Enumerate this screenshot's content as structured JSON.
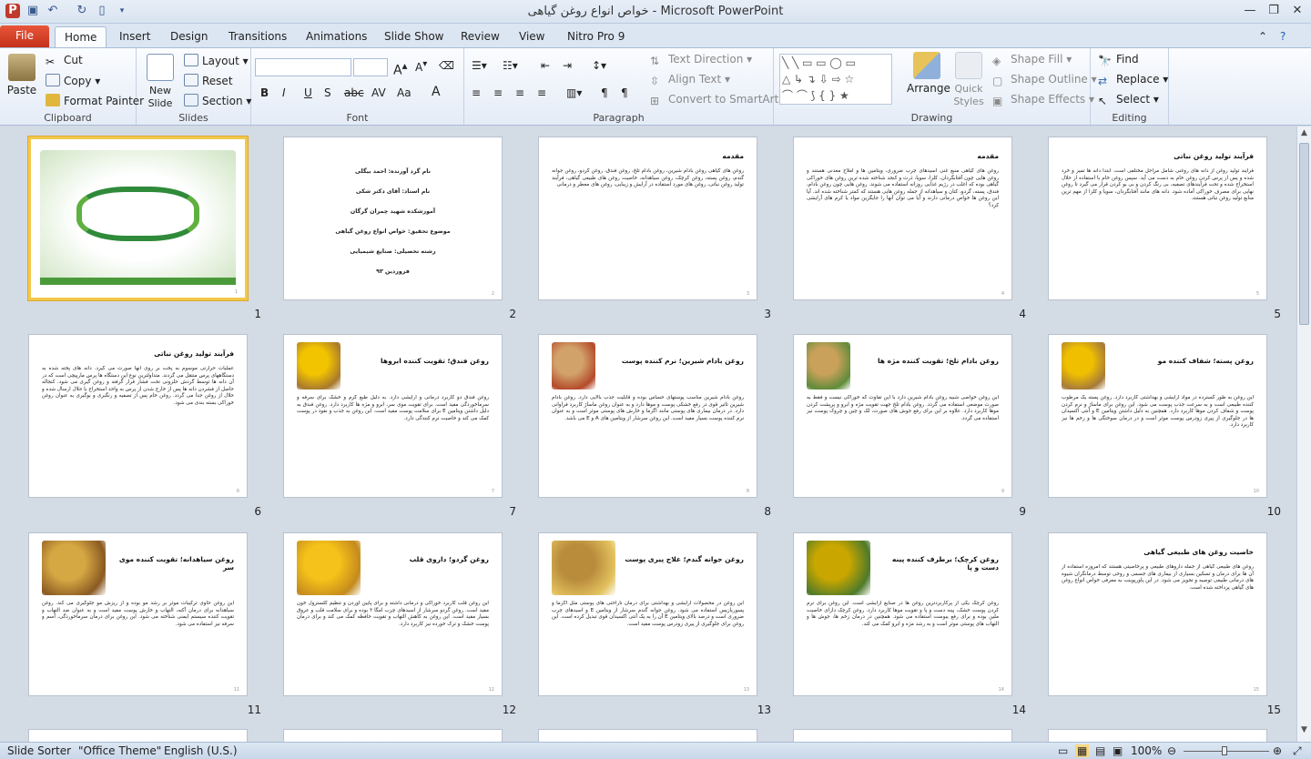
{
  "window": {
    "title": "خواص انواع روغن گیاهی  -  Microsoft PowerPoint"
  },
  "tabs": [
    "File",
    "Home",
    "Insert",
    "Design",
    "Transitions",
    "Animations",
    "Slide Show",
    "Review",
    "View",
    "Nitro Pro 9"
  ],
  "ribbon": {
    "clipboard": {
      "label": "Clipboard",
      "paste": "Paste",
      "cut": "Cut",
      "copy": "Copy",
      "format_painter": "Format Painter"
    },
    "slides": {
      "label": "Slides",
      "new_slide": "New Slide",
      "layout": "Layout",
      "reset": "Reset",
      "section": "Section"
    },
    "font": {
      "label": "Font"
    },
    "paragraph": {
      "label": "Paragraph",
      "text_direction": "Text Direction",
      "align_text": "Align Text",
      "convert": "Convert to SmartArt"
    },
    "drawing": {
      "label": "Drawing",
      "arrange": "Arrange",
      "quick_styles": "Quick Styles",
      "shape_fill": "Shape Fill",
      "shape_outline": "Shape Outline",
      "shape_effects": "Shape Effects"
    },
    "editing": {
      "label": "Editing",
      "find": "Find",
      "replace": "Replace",
      "select": "Select"
    }
  },
  "slides": [
    {
      "n": "1",
      "type": "title"
    },
    {
      "n": "2",
      "lines": [
        "نام گرد آورنده: احمد بیگلی",
        "نام استاد: آقای دکتر شکی",
        "آموزشکده شهید چمران گرگان",
        "موضوع تحقیق: خواص انواع روغن گیاهی",
        "رشته تحصیلی: صنایع شیمیایی",
        "فروردین ۹۳"
      ]
    },
    {
      "n": "3",
      "heading": "مقدمه",
      "body": "روغن های گیاهی روغن بادام شیرین، روغن بادام تلخ، روغن فندق، روغن گردو، روغن جوانه گندم، روغن پسته، روغن کرچک، روغن سیاهدانه، خاصیت روغن های طبیعی گیاهی، فرآیند تولید روغن نباتی، روغن های مورد استفاده در آرایش و زیبایی، روغن های معطر و درمانی"
    },
    {
      "n": "4",
      "heading": "مقدمه",
      "body": "روغن های گیاهی منبع غنی اسیدهای چرب ضروری، ویتامین ها و املاح معدنی هستند و روغن هایی چون آفتابگردان، کلزا، سویا، ذرت و کنجد شناخته شده ترین روغن های خوراکی گیاهی بوده که اغلب در رژیم غذایی روزانه استفاده می شوند. روغن هایی چون روغن بادام، فندق، پسته، گردو، کتان و سیاهدانه از جمله روغن هایی هستند که کمتر شناخته شده اند. آیا این روغن ها خواص درمانی دارند و آیا می توان آنها را جایگزین مواد یا کرم های آرایشی کرد؟"
    },
    {
      "n": "5",
      "heading": "فرآیند تولید روغن نباتی",
      "body": "فرآیند تولید روغن از دانه های روغنی شامل مراحل مختلفی است. ابتدا دانه ها تمیز و خرد شده و پس از پرس کردن روغن خام به دست می آید. سپس روغن خام با استفاده از حلال استخراج شده و تحت فرآیندهای تصفیه، بی رنگ کردن و بی بو کردن قرار می گیرد تا روغن نهایی برای مصرف خوراکی آماده شود. دانه های مانند آفتابگردان، سویا و کلزا از مهم ترین منابع تولید روغن نباتی هستند."
    },
    {
      "n": "6",
      "heading": "فرآیند تولید روغن نباتی",
      "body": "عملیات حرارتی موسوم به پخت بر روی آنها صورت می گیرد. دانه های پخته شده به دستگاههای پرس منتقل می گردند. متداولترین نوع این دستگاه ها پرس مارپیچی است که در آن دانه ها توسط گردش حلزونی تحت فشار قرار گرفته و روغن گیری می شود. کنجاله حاصل از فشردن دانه ها پس از خارج شدن از پرس به واحد استخراج با حلال ارسال شده و حلال از روغن جدا می گردد. روغن خام پس از تصفیه و رنگبری و بوگیری به عنوان روغن خوراکی بسته بندی می شود."
    },
    {
      "n": "7",
      "heading": "روغن فندق؛ تقویت کننده ابروها",
      "body": "روغن فندق دو کاربرد درمانی و آرایشی دارد. به دلیل طبع گرم و خشک برای سرفه و سرماخوردگی مفید است. برای تقویت موی سر، ابرو و مژه ها کاربرد دارد. روغن فندق به دلیل داشتن ویتامین E برای سلامت پوست مفید است. این روغن به جذب و نفوذ در پوست کمک می کند و خاصیت نرم کنندگی دارد."
    },
    {
      "n": "8",
      "heading": "روغن بادام شیرین؛ نرم کننده پوست",
      "body": "روغن بادام شیرین مناسب پوستهای حساس بوده و قابلیت جذب بالایی دارد. روغن بادام شیرین تاثیر قوی در رفع خشکی پوست و موها دارد و به عنوان روغن ماساژ کاربرد فراوانی دارد. در درمان بیماری های پوستی مانند اگزما و خارش های پوستی موثر است و به عنوان نرم کننده پوست بسیار مفید است. این روغن سرشار از ویتامین های A و E می باشد."
    },
    {
      "n": "9",
      "heading": "روغن بادام تلخ؛ تقویت کننده مژه ها",
      "body": "این روغن خواصی شبیه روغن بادام شیرین دارد با این تفاوت که خوراکی نیست و فقط به صورت موضعی استفاده می گردد. روغن بادام تلخ جهت تقویت مژه و ابرو و پرپشت کردن موها کاربرد دارد. علاوه بر این برای رفع جوش های صورت، لک و چین و چروک پوست نیز استفاده می گردد."
    },
    {
      "n": "10",
      "heading": "روغن پسته؛ شفاف کننده مو",
      "body": "این روغن به طور گسترده در مواد آرایشی و بهداشتی کاربرد دارد. روغن پسته یک مرطوب کننده طبیعی است و به سرعت جذب پوست می شود. این روغن برای ماساژ و نرم کردن پوست و شفاف کردن موها کاربرد دارد. همچنین به دلیل داشتن ویتامین E و آنتی اکسیدان ها در جلوگیری از پیری زودرس پوست موثر است و در درمان سوختگی ها و زخم ها نیز کاربرد دارد."
    },
    {
      "n": "11",
      "heading": "روغن سیاهدانه؛ تقویت کننده موی سر",
      "body": "این روغن حاوی ترکیبات موثر بر رشد مو بوده و از ریزش مو جلوگیری می کند. روغن سیاهدانه برای درمان آکنه، التهاب و خارش پوست مفید است و به عنوان ضد التهاب و تقویت کننده سیستم ایمنی شناخته می شود. این روغن برای درمان سرماخوردگی، آسم و سرفه نیز استفاده می شود."
    },
    {
      "n": "12",
      "heading": "روغن گردو؛ داروی قلب",
      "body": "این روغن قلب کاربرد خوراکی و درمانی داشته و برای پایین آوردن و تنظیم کلسترول خون مفید است. روغن گردو سرشار از اسیدهای چرب امگا ۳ بوده و برای سلامت قلب و عروق بسیار مفید است. این روغن به کاهش التهاب و تقویت حافظه کمک می کند و برای درمان پوست خشک و ترک خورده نیز کاربرد دارد."
    },
    {
      "n": "13",
      "heading": "روغن جوانه گندم؛ علاج پیری پوست",
      "body": "این روغن در محصولات آرایشی و بهداشتی برای درمان ناراحتی های پوستی مثل اگزما و پسوریازیس استفاده می شود. روغن جوانه گندم سرشار از ویتامین E و اسیدهای چرب ضروری است و درصد بالای ویتامین E آن را به یک آنتی اکسیدان قوی تبدیل کرده است. این روغن برای جلوگیری از پیری زودرس پوست مفید است."
    },
    {
      "n": "14",
      "heading": "روغن کرچک؛ برطرف کننده پینه دست و پا",
      "body": "روغن کرچک یکی از پرکاربردترین روغن ها در صنایع آرایشی است. این روغن برای نرم کردن پوست خشک، پینه دست و پا و تقویت موها کاربرد دارد. روغن کرچک دارای خاصیت ملین بوده و برای رفع یبوست استفاده می شود. همچنین در درمان زخم ها، جوش ها و التهاب های پوستی موثر است و به رشد مژه و ابرو کمک می کند."
    },
    {
      "n": "15",
      "heading": "خاصیت روغن های طبیعی گیاهی",
      "body": "روغن های طبیعی گیاهی از جمله داروهای طبیعی و پرخاصیتی هستند که امروزه استفاده از آن ها برای درمان و تسکین بسیاری از بیماری های جسمی و روحی توسط درمانگران شیوه های درمانی طبیعی توصیه و تجویز می شود. در این پاورپوینت به معرفی خواص انواع روغن های گیاهی پرداخته شده است."
    }
  ],
  "status": {
    "slide_sorter": "Slide Sorter",
    "theme": "\"Office Theme\"",
    "language": "English (U.S.)",
    "zoom": "100%"
  }
}
